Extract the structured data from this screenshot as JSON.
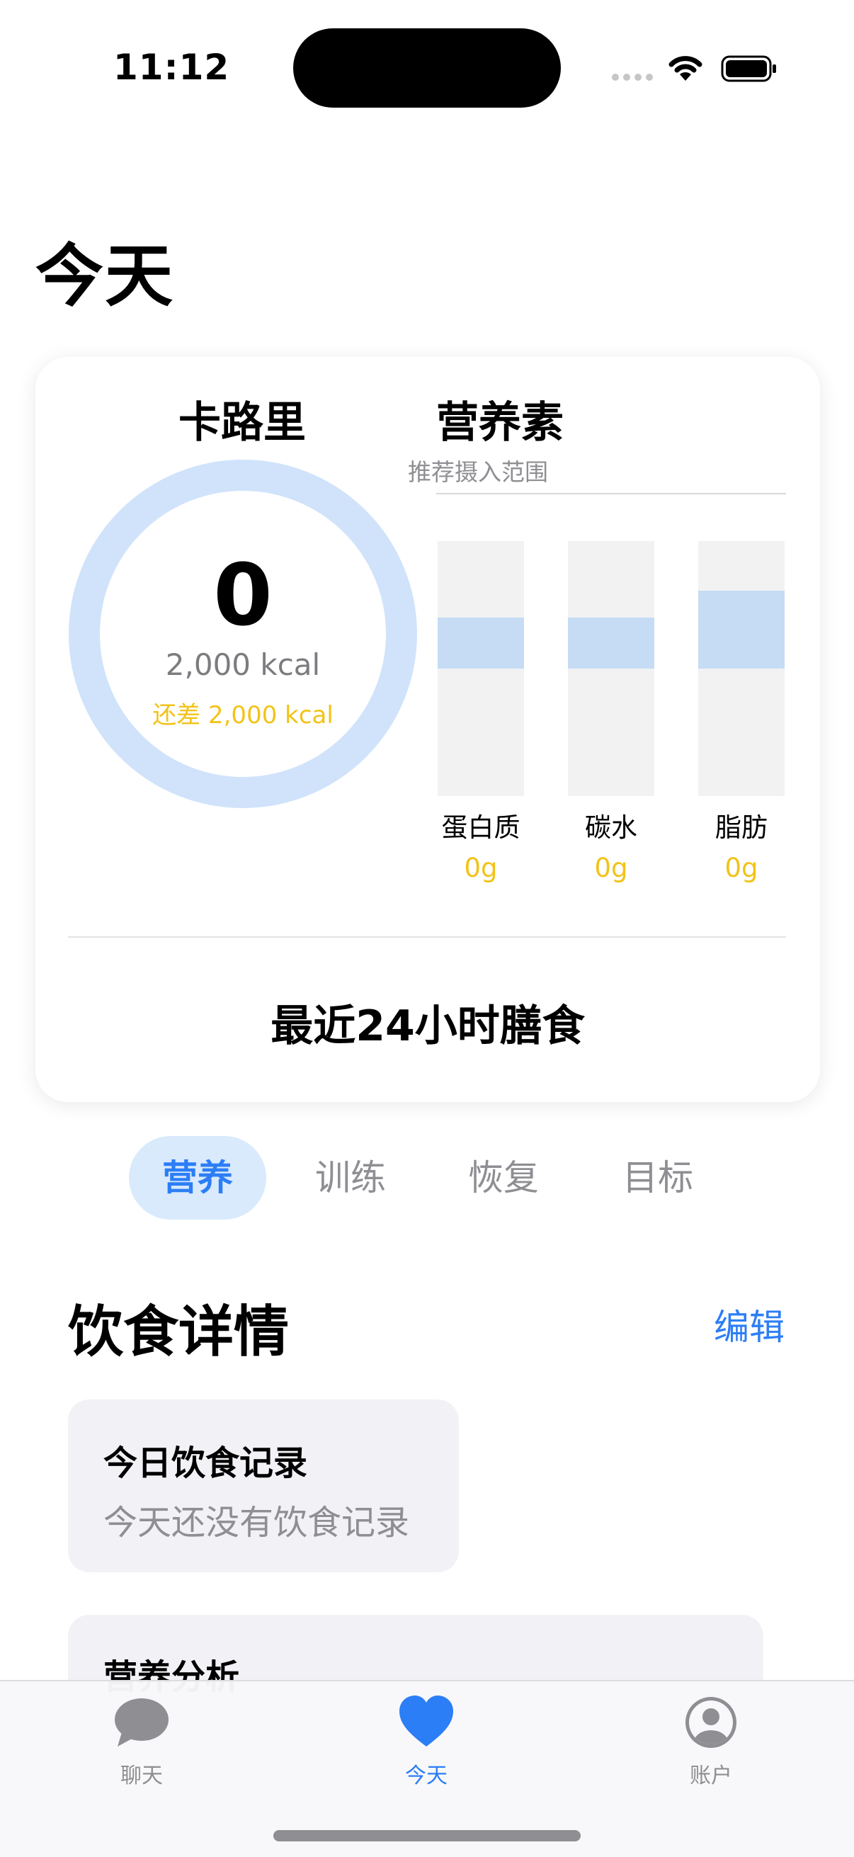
{
  "status_bar": {
    "time": "11:12"
  },
  "page": {
    "title": "今天"
  },
  "summary": {
    "calories": {
      "title": "卡路里",
      "value": "0",
      "goal": "2,000 kcal",
      "remaining": "还差 2,000 kcal",
      "progress": 0
    },
    "nutrients": {
      "title": "营养素",
      "subtitle": "推荐摄入范围",
      "items": [
        {
          "label": "蛋白质",
          "value": "0g"
        },
        {
          "label": "碳水",
          "value": "0g"
        },
        {
          "label": "脂肪",
          "value": "0g"
        }
      ]
    },
    "recent_meals_label": "最近24小时膳食"
  },
  "segments": {
    "items": [
      "营养",
      "训练",
      "恢复",
      "目标"
    ],
    "selected": "营养"
  },
  "diet": {
    "title": "饮食详情",
    "edit_label": "编辑",
    "log_card": {
      "title": "今日饮食记录",
      "empty": "今天还没有饮食记录"
    },
    "analysis_card": {
      "title": "营养分析"
    }
  },
  "tab_bar": {
    "items": [
      {
        "label": "聊天",
        "icon": "chat-bubble-icon"
      },
      {
        "label": "今天",
        "icon": "heart-icon"
      },
      {
        "label": "账户",
        "icon": "person-circle-icon"
      }
    ],
    "selected": "今天"
  },
  "colors": {
    "accent": "#2c7ef6",
    "warning": "#f2c318",
    "ring_track": "#d0e3fb",
    "range_fill": "#c5dcf4"
  }
}
